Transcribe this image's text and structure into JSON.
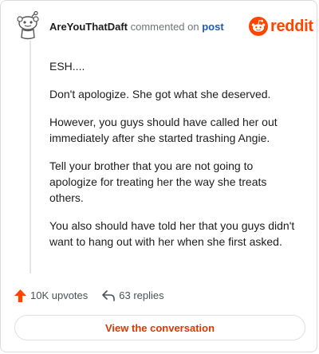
{
  "comment": {
    "username": "AreYouThatDaft",
    "action_text": "commented on",
    "post_link": "post",
    "paragraphs": [
      "ESH....",
      "Don't apologize. She got what she deserved.",
      "However, you guys should have called her out immediately after she started trashing Angie.",
      "Tell your brother that you are not going to apologize for treating her the way she treats others.",
      "You also should have told her that you guys didn't want to hang out with her when she first asked."
    ]
  },
  "brand": {
    "wordmark": "reddit",
    "color": "#ff4500"
  },
  "actions": {
    "upvotes_label": "10K upvotes",
    "replies_label": "63 replies"
  },
  "cta": {
    "label": "View the conversation"
  },
  "icons": {
    "avatar": "snoo-avatar-icon",
    "logo": "reddit-alien-icon",
    "upvote": "upvote-arrow-icon",
    "reply": "reply-arrow-icon"
  }
}
